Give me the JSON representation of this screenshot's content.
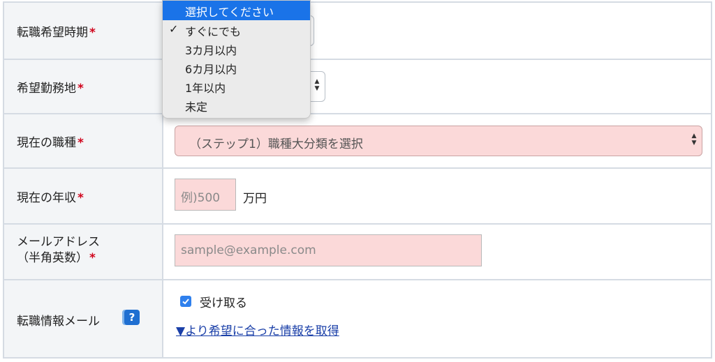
{
  "form": {
    "rows": [
      {
        "label": "転職希望時期",
        "required": "*"
      },
      {
        "label": "希望勤務地",
        "required": "*"
      },
      {
        "label": "現在の職種",
        "required": "*"
      },
      {
        "label": "現在の年収",
        "required": "*"
      },
      {
        "label_line1": "メールアドレス",
        "label_line2": "（半角英数）",
        "required": "*"
      },
      {
        "label": "転職情報メール"
      }
    ],
    "occupation_select": {
      "value": "（ステップ1）職種大分類を選択"
    },
    "income_input": {
      "placeholder": "例)500",
      "unit": "万円"
    },
    "email_input": {
      "placeholder": "sample@example.com"
    },
    "newsletter": {
      "checkbox_label": "受け取る",
      "checked": true,
      "link": "▼より希望に合った情報を取得",
      "help": "?"
    }
  },
  "dropdown": {
    "options": [
      {
        "label": "選択してください",
        "highlighted": true
      },
      {
        "label": "すぐにでも",
        "checked": true
      },
      {
        "label": "3カ月以内"
      },
      {
        "label": "6カ月以内"
      },
      {
        "label": "1年以内"
      },
      {
        "label": "未定"
      }
    ],
    "check_mark": "✓"
  },
  "colors": {
    "required": "#d0021b",
    "error_field": "#fbd9d9",
    "highlight": "#1a73e8",
    "link": "#1a3fa8",
    "checkbox": "#2f80ed"
  }
}
